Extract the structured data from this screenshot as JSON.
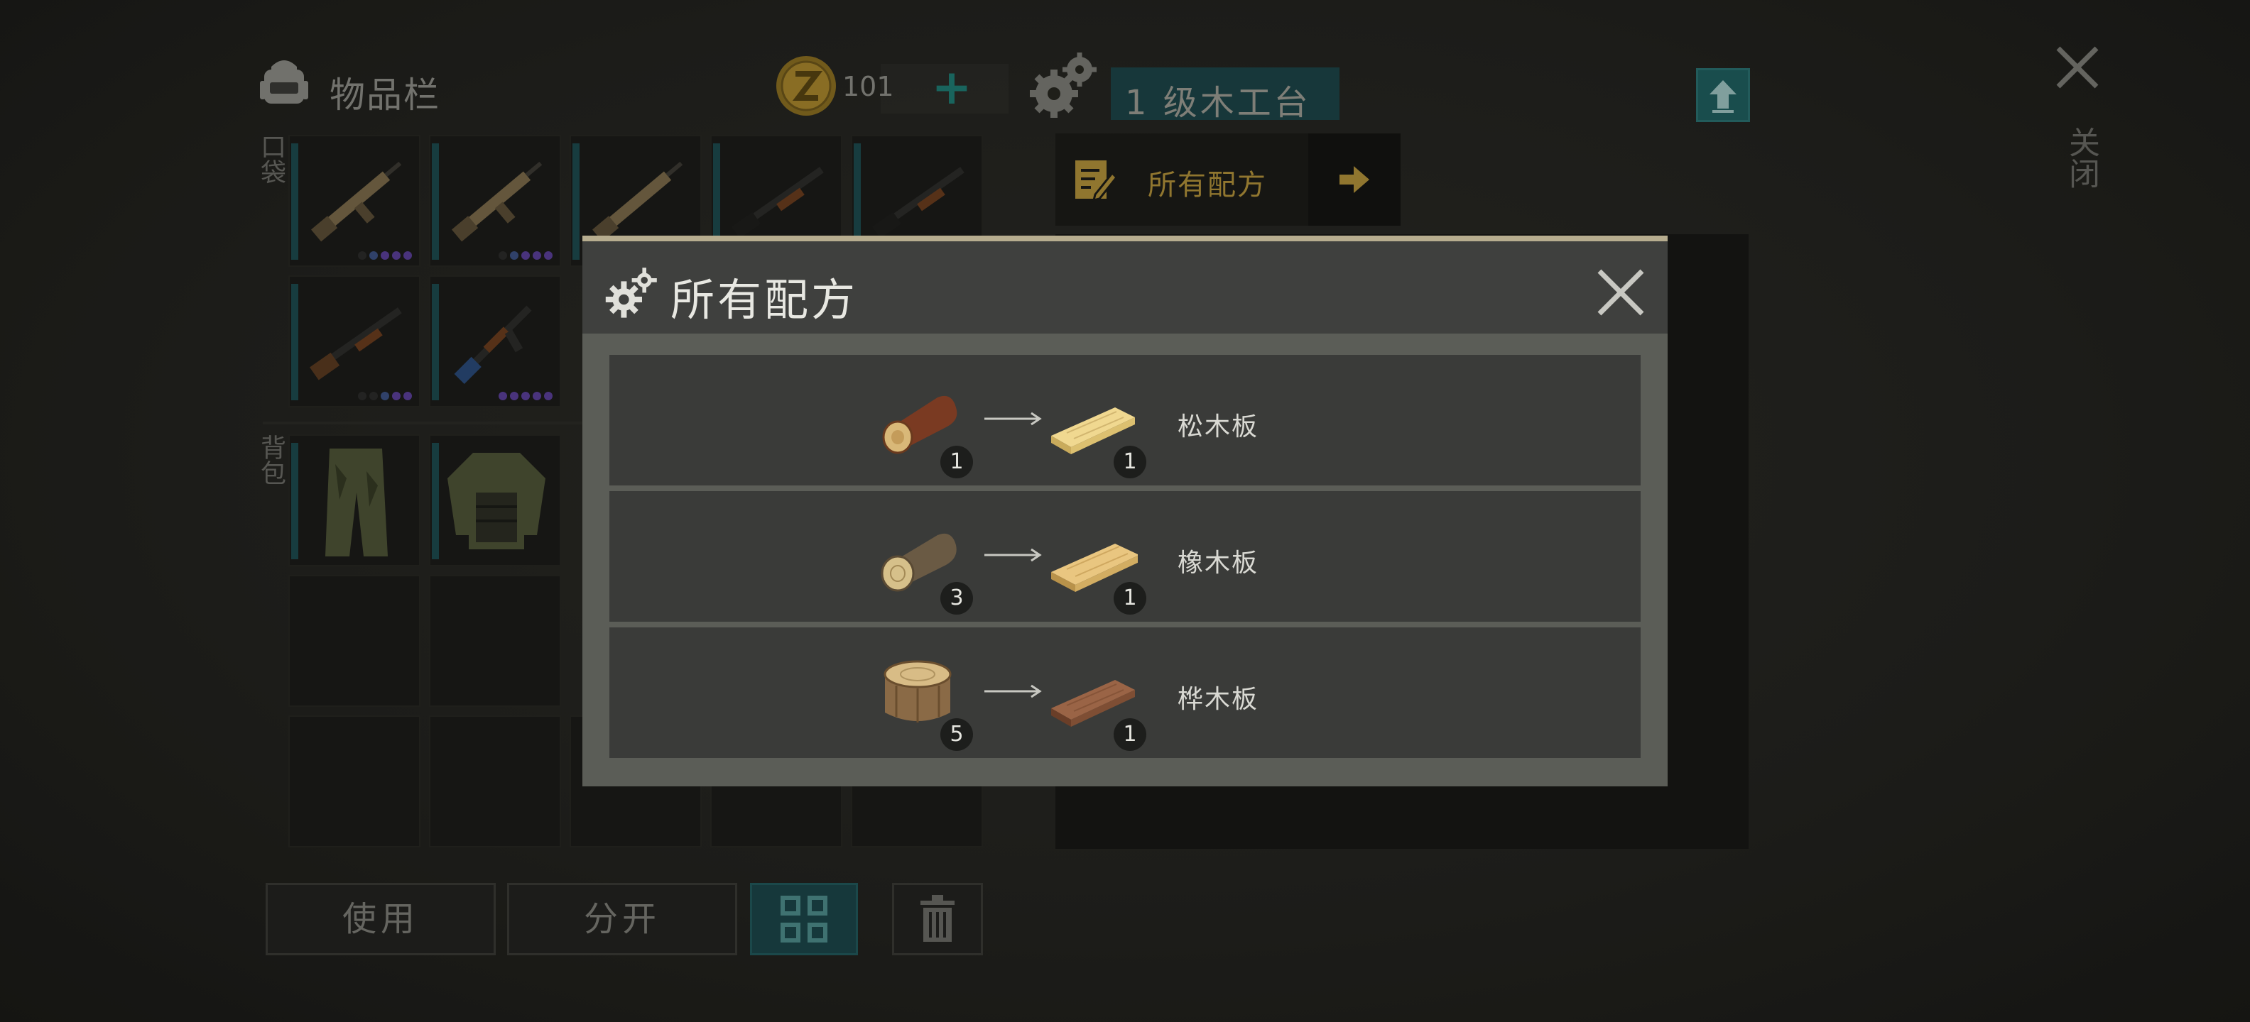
{
  "inventory": {
    "title": "物品栏",
    "coins": "101"
  },
  "workbench": {
    "title": "1 级木工台"
  },
  "close": {
    "label": "关闭"
  },
  "tab": {
    "label": "所有配方"
  },
  "sections": {
    "pocket": "口袋",
    "backpack": "背包"
  },
  "buttons": {
    "use": "使用",
    "split": "分开"
  },
  "modal": {
    "title": "所有配方",
    "recipes": [
      {
        "input_icon": "pine-log-icon",
        "input_count": "1",
        "output_icon": "pine-plank-icon",
        "output_count": "1",
        "name": "松木板"
      },
      {
        "input_icon": "oak-log-icon",
        "input_count": "3",
        "output_icon": "oak-plank-icon",
        "output_count": "1",
        "name": "橡木板"
      },
      {
        "input_icon": "birch-stump-icon",
        "input_count": "5",
        "output_icon": "birch-plank-icon",
        "output_count": "1",
        "name": "桦木板"
      }
    ]
  },
  "colors": {
    "accent_teal": "#1f5e5e",
    "tab_gold": "#b0903a",
    "modal_bg": "#3b3c3a"
  }
}
